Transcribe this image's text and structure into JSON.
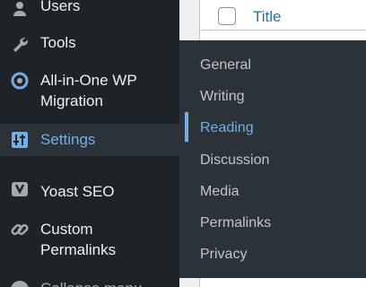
{
  "menu": {
    "items": [
      {
        "label": "Users",
        "icon": "users-icon"
      },
      {
        "label": "Tools",
        "icon": "wrench-icon"
      },
      {
        "label": "All-in-One WP",
        "label2": "Migration",
        "icon": "migration-icon"
      },
      {
        "label": "Settings",
        "icon": "sliders-icon",
        "current": true
      },
      {
        "label": "Yoast SEO",
        "icon": "yoast-icon"
      },
      {
        "label": "Custom",
        "label2": "Permalinks",
        "icon": "link-icon"
      }
    ],
    "collapse_label": "Collapse menu"
  },
  "table": {
    "title_column": "Title"
  },
  "submenu": {
    "items": [
      "General",
      "Writing",
      "Reading",
      "Discussion",
      "Media",
      "Permalinks",
      "Privacy"
    ],
    "current": "Reading"
  },
  "colors": {
    "menu_bg": "#1d2327",
    "flyout_bg": "#2c3338",
    "accent": "#72aee6",
    "link": "#2271b1"
  }
}
